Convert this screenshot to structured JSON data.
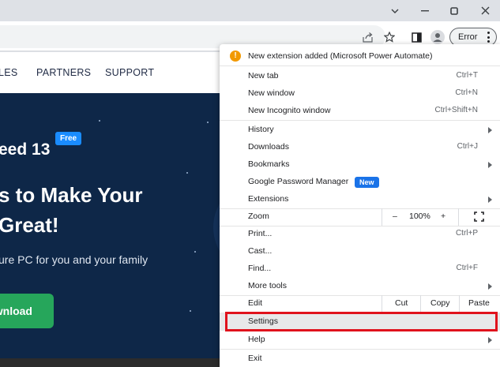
{
  "window": {
    "minimize_icon": "minimize-icon",
    "restore_icon": "restore-icon",
    "close_icon": "close-icon",
    "chevron_icon": "chevron-down-icon"
  },
  "toolbar": {
    "share_icon": "share-icon",
    "star_icon": "star-icon",
    "sidepanel_icon": "side-panel-icon",
    "profile_icon": "profile-icon",
    "error_label": "Error"
  },
  "site": {
    "nav": [
      "LES",
      "PARTNERS",
      "SUPPORT"
    ],
    "hero_title": "eed 13",
    "free_badge": "Free",
    "headline_1": "s to Make Your",
    "headline_2": "Great!",
    "subtitle": "ure PC for you and your family",
    "download_label": "wnload"
  },
  "menu": {
    "notice": "New extension added (Microsoft Power Automate)",
    "new_tab": "New tab",
    "new_tab_sc": "Ctrl+T",
    "new_window": "New window",
    "new_window_sc": "Ctrl+N",
    "incognito": "New Incognito window",
    "incognito_sc": "Ctrl+Shift+N",
    "history": "History",
    "downloads": "Downloads",
    "downloads_sc": "Ctrl+J",
    "bookmarks": "Bookmarks",
    "password_manager": "Google Password Manager",
    "new_badge": "New",
    "extensions": "Extensions",
    "zoom": "Zoom",
    "zoom_minus": "–",
    "zoom_value": "100%",
    "zoom_plus": "+",
    "print": "Print...",
    "print_sc": "Ctrl+P",
    "cast": "Cast...",
    "find": "Find...",
    "find_sc": "Ctrl+F",
    "more_tools": "More tools",
    "edit": "Edit",
    "cut": "Cut",
    "copy": "Copy",
    "paste": "Paste",
    "settings": "Settings",
    "help": "Help",
    "exit": "Exit"
  },
  "colors": {
    "highlight_outline": "#e0121c",
    "hero_bg": "#0e2748",
    "download_btn": "#26a65b",
    "badge_blue": "#1a73e8"
  }
}
